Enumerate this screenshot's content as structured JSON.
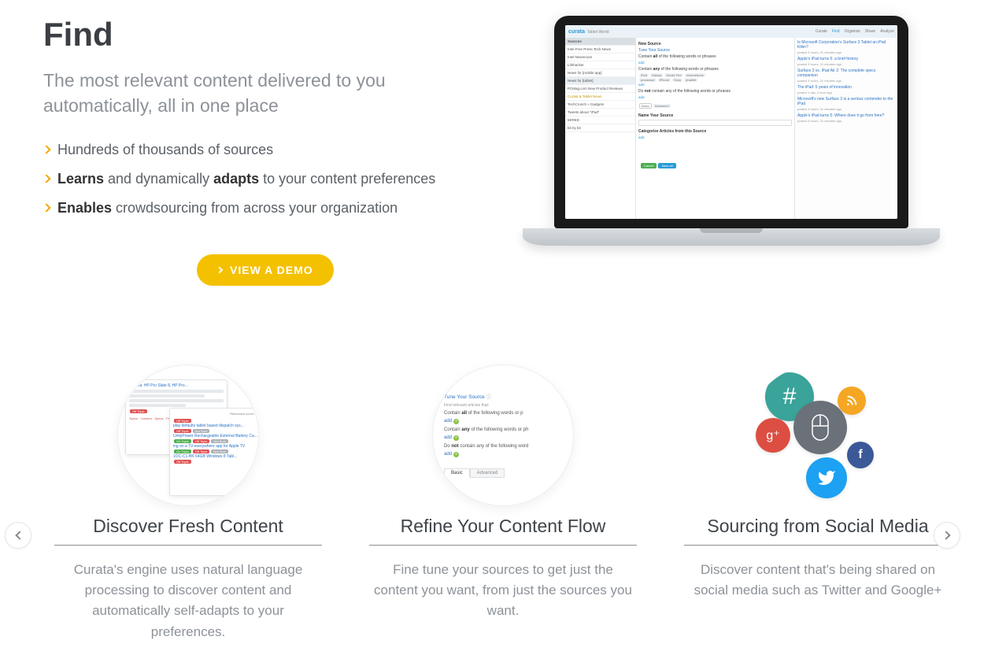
{
  "hero": {
    "title": "Find",
    "subtitle": "The most relevant content delivered to you automatically, all in one place",
    "bullets": [
      {
        "html": "Hundreds of thousands of sources"
      },
      {
        "html": "<b>Learns</b> and dynamically <b>adapts</b> to your content preferences"
      },
      {
        "html": "<b>Enables</b> crowdsourcing from across your organization"
      }
    ],
    "cta": "VIEW A DEMO"
  },
  "laptop": {
    "brand": "curata",
    "brand_sub": "Tablet World",
    "nav": [
      "Curate",
      "Find",
      "Organize",
      "Share",
      "Analyze"
    ],
    "nav_active": 1,
    "left_header": "Sources",
    "sources": [
      "Intel Free Press Tech News",
      "Intel Newsroom",
      "Lifehacker",
      "News for [mobile app]",
      "News for [tablet]",
      "PCMag.com New Product Reviews",
      "Curata & Tablet News",
      "TechCrunch » Gadgets",
      "Tweets about \"iPad\"",
      "WIRED",
      "bit by bit"
    ],
    "center": {
      "heading": "New Source",
      "tune": "Tune Your Source",
      "rules": [
        {
          "pre": "Contain",
          "mid": "all",
          "post": "of the following words or phrases"
        },
        {
          "pre": "Contain",
          "mid": "any",
          "post": "of the following words or phrases"
        },
        {
          "pre": "Do",
          "mid": "not",
          "post": "contain any of the following words or phrases"
        }
      ],
      "tags": [
        "iPad",
        "Galaxy",
        "Kindle Fire",
        "chromebook",
        "processor",
        "iPhone",
        "Sony",
        "phablet"
      ],
      "add": "add",
      "tabs": [
        "Basic",
        "Advanced"
      ],
      "name_src": "Name Your Source",
      "cat": "Categorize Articles from this Source"
    },
    "right": [
      {
        "t": "Is Microsoft Corporation's Surface 3 Tablet an iPad Killer?",
        "m": "posted 3 hours, 31 minutes ago"
      },
      {
        "t": "Apple's iPad turns 5: a brief history",
        "m": "posted 3 hours, 31 minutes ago"
      },
      {
        "t": "Surface 3 vs. iPad Air 2: The complete specs comparison",
        "m": "posted 3 hours, 31 minutes ago"
      },
      {
        "t": "The iPad: 5 years of innovation",
        "m": "posted 1 day, 1 hour ago"
      },
      {
        "t": "Microsoft's new Surface 3 is a serious contender to the iPad",
        "m": "posted 3 hours, 31 minutes ago"
      },
      {
        "t": "Apple's iPad turns 5: Where does it go from here?",
        "m": "posted 3 hours, 31 minutes ago"
      }
    ],
    "buttons": [
      "Cancel",
      "Save all"
    ]
  },
  "features": [
    {
      "title": "Discover Fresh Content",
      "desc": "Curata's engine uses natural language processing to discover content and automatically self-adapts to your preferences."
    },
    {
      "title": "Refine Your Content Flow",
      "desc": "Fine tune your sources to get just the content you want, from just the sources you want."
    },
    {
      "title": "Sourcing from Social Media",
      "desc": "Discover content that's being shared on social media such as Twitter and Google+"
    }
  ],
  "feature2_panel": {
    "heading": "Tune Your Source",
    "sub": "Find relevant articles that:",
    "rules": [
      {
        "pre": "Contain",
        "mid": "all",
        "post": "of the following words or p"
      },
      {
        "pre": "Contain",
        "mid": "any",
        "post": "of the following words or ph"
      },
      {
        "pre": "Do",
        "mid": "not",
        "post": "contain any of the following word"
      }
    ],
    "add": "add",
    "tabs": [
      "Basic",
      "Advanced"
    ]
  }
}
